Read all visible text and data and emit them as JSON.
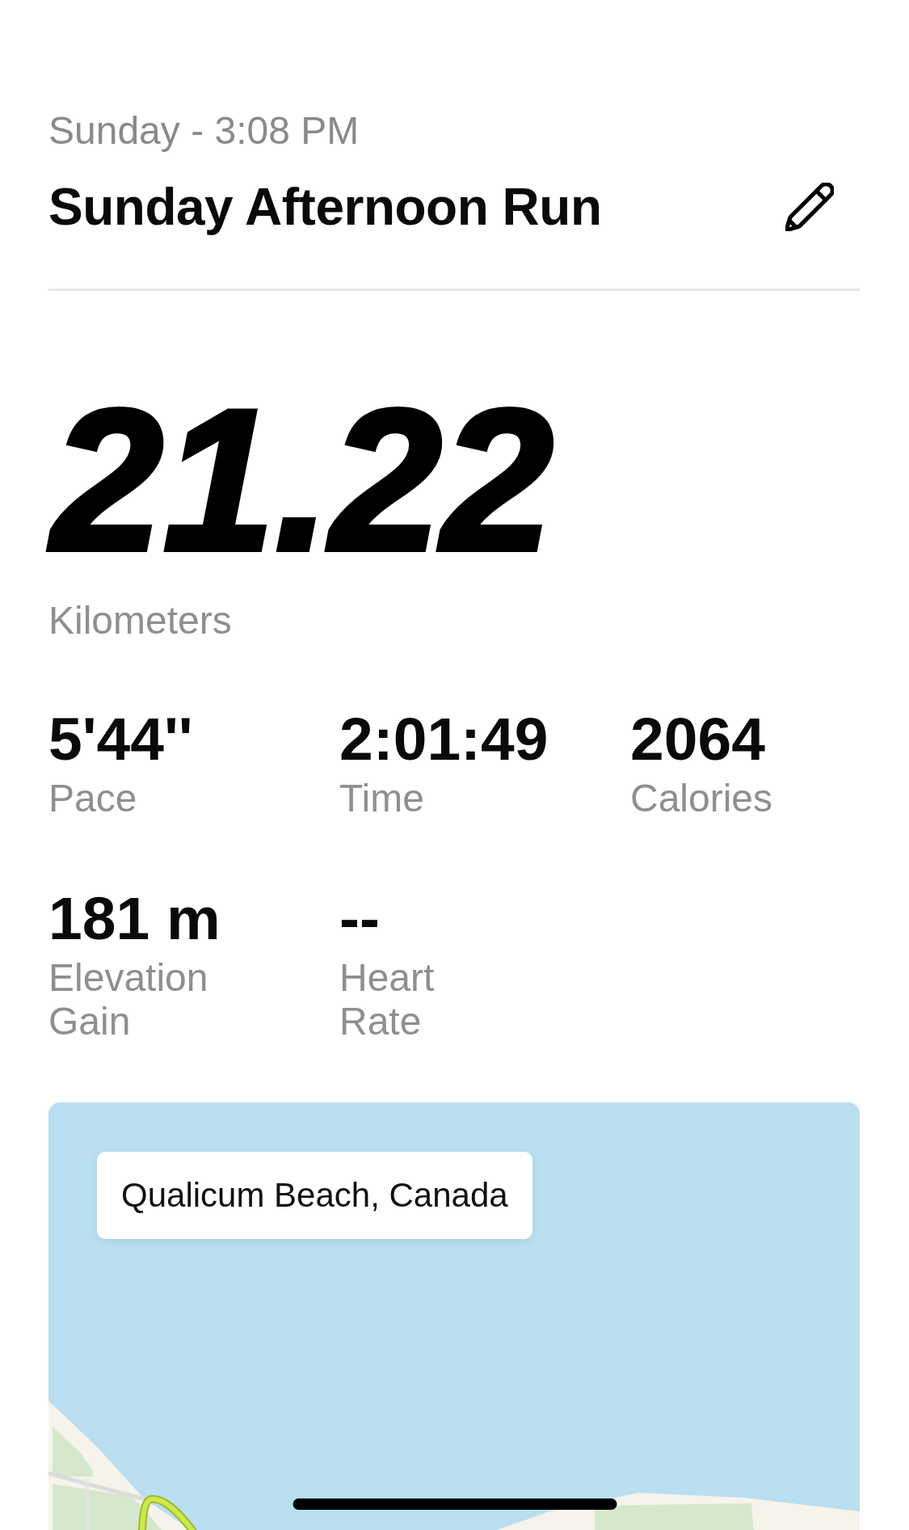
{
  "activity": {
    "date": "Sunday - 3:08 PM",
    "title": "Sunday Afternoon Run"
  },
  "distance": {
    "value": "21.22",
    "unit": "Kilometers"
  },
  "stats": [
    {
      "value": "5'44''",
      "label": "Pace"
    },
    {
      "value": "2:01:49",
      "label": "Time"
    },
    {
      "value": "2064",
      "label": "Calories"
    },
    {
      "value": "181 m",
      "label": "Elevation Gain"
    },
    {
      "value": "--",
      "label": "Heart Rate"
    }
  ],
  "map": {
    "location": "Qualicum Beach, Canada"
  }
}
